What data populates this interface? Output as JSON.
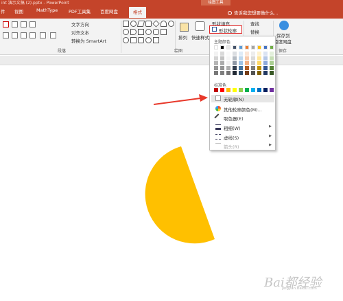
{
  "titlebar": {
    "document": "int 演示文稿 (2).pptx - PowerPoint",
    "context_label": "绘图工具"
  },
  "tabs": [
    {
      "label": "件"
    },
    {
      "label": "视图"
    },
    {
      "label": "MathType"
    },
    {
      "label": "PDF工具集"
    },
    {
      "label": "百度网盘"
    },
    {
      "label": "格式"
    }
  ],
  "tell_me": "告诉我您想要做什么...",
  "ribbon": {
    "para_group": "段落",
    "drawing_group": "绘图",
    "edit_group": "编辑",
    "save_group": "保存",
    "text_direction": "文字方向",
    "align_text": "对齐文本",
    "smartart": "转换为 SmartArt",
    "arrange": "排列",
    "quick_styles": "快速样式",
    "shape_fill": "形状填充",
    "shape_outline": "形状轮廓",
    "find": "查找",
    "replace": "替换",
    "save_to": "保存到",
    "baidu": "百度网盘"
  },
  "menu": {
    "theme_colors_label": "主题颜色",
    "standard_colors_label": "标准色",
    "no_outline": "无轮廓(N)",
    "more_colors": "其他轮廓颜色(M)...",
    "eyedropper": "取色器(E)",
    "weight": "粗细(W)",
    "dashes": "虚线(S)",
    "arrows": "箭头(R)",
    "theme_top": [
      "#ffffff",
      "#000000",
      "#e7e6e6",
      "#44546a",
      "#5b9bd5",
      "#ed7d31",
      "#a5a5a5",
      "#ffc000",
      "#4472c4",
      "#70ad47"
    ],
    "standard": [
      "#c00000",
      "#ff0000",
      "#ffc000",
      "#ffff00",
      "#92d050",
      "#00b050",
      "#00b0f0",
      "#0070c0",
      "#002060",
      "#7030a0"
    ]
  },
  "shape_color": "#ffc000",
  "arrow_color": "#e8382a",
  "watermark": {
    "text": "Bai都经验",
    "sub": "jingyan.baidu.com"
  }
}
